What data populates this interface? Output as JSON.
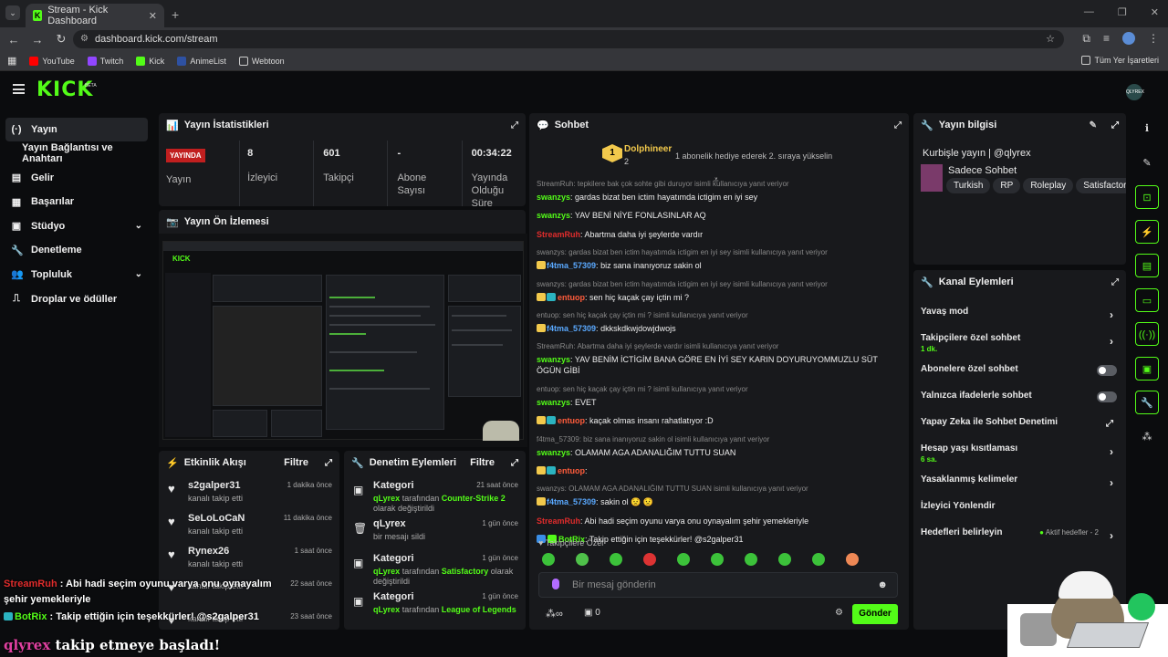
{
  "browser": {
    "tab_title": "Stream - Kick Dashboard",
    "url": "dashboard.kick.com/stream",
    "bookmarks": [
      {
        "label": "YouTube",
        "color": "#ff0000"
      },
      {
        "label": "Twitch",
        "color": "#9146ff"
      },
      {
        "label": "Kick",
        "color": "#53fc18"
      },
      {
        "label": "AnimeList",
        "color": "#2e51a2"
      },
      {
        "label": "Webtoon",
        "color": "#00dc64"
      }
    ],
    "bookmarks_right": "Tüm Yer İşaretleri"
  },
  "header": {
    "logo": "KICK",
    "beta": "BETA",
    "profile": "QLYREX"
  },
  "sidebar": {
    "items": [
      {
        "label": "Yayın",
        "icon": "(·)"
      },
      {
        "label": "Yayın Bağlantısı ve Anahtarı",
        "icon": ""
      },
      {
        "label": "Gelir",
        "icon": "▤"
      },
      {
        "label": "Başarılar",
        "icon": "▦"
      },
      {
        "label": "Stüdyo",
        "icon": "▣"
      },
      {
        "label": "Denetleme",
        "icon": "🔧"
      },
      {
        "label": "Topluluk",
        "icon": "👥"
      },
      {
        "label": "Droplar ve ödüller",
        "icon": "⎍"
      }
    ]
  },
  "stats": {
    "title": "Yayın İstatistikleri",
    "live": "YAYINDA",
    "items": [
      {
        "value": "",
        "label": "Yayın"
      },
      {
        "value": "8",
        "label": "İzleyici"
      },
      {
        "value": "601",
        "label": "Takipçi"
      },
      {
        "value": "-",
        "label": "Abone Sayısı"
      },
      {
        "value": "00:34:22",
        "label": "Yayında Olduğu Süre"
      }
    ]
  },
  "preview": {
    "title": "Yayın Ön İzlemesi",
    "overlay_user": "qlyrex",
    "overlay_text": "takip etmeye başladı!"
  },
  "activity": {
    "title": "Etkinlik Akışı",
    "filter": "Filtre",
    "rows": [
      {
        "name": "s2galper31",
        "desc": "kanalı takip etti",
        "time": "1 dakika önce"
      },
      {
        "name": "SeLoLoCaN",
        "desc": "kanalı takip etti",
        "time": "11 dakika önce"
      },
      {
        "name": "Rynex26",
        "desc": "kanalı takip etti",
        "time": "1 saat önce"
      },
      {
        "name": "",
        "desc": "kanalı takip etti",
        "time": "22 saat önce"
      },
      {
        "name": "",
        "desc": "kanalı takip etti",
        "time": "23 saat önce"
      }
    ]
  },
  "moderation": {
    "title": "Denetim Eylemleri",
    "filter": "Filtre",
    "rows": [
      {
        "title": "Kategori",
        "user": "qLyrex",
        "pre": "tarafından",
        "value": "Counter-Strike 2",
        "post": "olarak değiştirildi",
        "time": "21 saat önce"
      },
      {
        "title": "qLyrex",
        "user": "",
        "pre": "bir mesajı sildi",
        "value": "",
        "post": "",
        "time": "1 gün önce"
      },
      {
        "title": "Kategori",
        "user": "qLyrex",
        "pre": "tarafından",
        "value": "Satisfactory",
        "post": "olarak değiştirildi",
        "time": "1 gün önce"
      },
      {
        "title": "Kategori",
        "user": "qLyrex",
        "pre": "tarafından",
        "value": "League of Legends",
        "post": "",
        "time": "1 gün önce"
      }
    ]
  },
  "chat": {
    "title": "Sohbet",
    "pinned_user": "Dolphineer",
    "pinned_count": "2",
    "pinned_rank": "1",
    "pinned_text": "1 abonelik hediye ederek 2. sıraya yükselin",
    "messages": [
      {
        "reply": "StreamRuh: tepkilere bak çok sohte gibi duruyor isimli kullanıcıya yanıt veriyor",
        "user": "swanzys",
        "cls": "ug",
        "text": "gardas bizat ben ictim hayatımda ictigim en iyi sey",
        "badges": 0
      },
      {
        "reply": "",
        "user": "swanzys",
        "cls": "ug",
        "text": "YAV BENİ NİYE FONLASINLAR AQ",
        "badges": 0
      },
      {
        "reply": "",
        "user": "StreamRuh",
        "cls": "ur",
        "text": "Abartma daha iyi şeylerde vardır",
        "badges": 0
      },
      {
        "reply": "swanzys: gardas bizat ben ictim hayatımda ictigim en iyi sey isimli kullanıcıya yanıt veriyor",
        "user": "f4tma_57309",
        "cls": "ub",
        "text": "biz sana inanıyoruz sakin ol",
        "badges": 1
      },
      {
        "reply": "swanzys: gardas bizat ben ictim hayatımda ictigim en iyi sey isimli kullanıcıya yanıt veriyor",
        "user": "entuop",
        "cls": "uo",
        "text": "sen hiç kaçak çay içtin mi ?",
        "badges": 2
      },
      {
        "reply": "entuop: sen hiç kaçak çay içtin mi ? isimli kullanıcıya yanıt veriyor",
        "user": "f4tma_57309",
        "cls": "ub",
        "text": "dkkskdkwjdowjdwojs",
        "badges": 1
      },
      {
        "reply": "StreamRuh: Abartma daha iyi şeylerde vardır isimli kullanıcıya yanıt veriyor",
        "user": "swanzys",
        "cls": "ug",
        "text": "YAV BENİM İCTİGİM BANA GÖRE EN İYİ SEY KARIN DOYURUYOMMUZLU SÜT ÖGÜN GİBİ",
        "badges": 0
      },
      {
        "reply": "entuop: sen hiç kaçak çay içtin mi ? isimli kullanıcıya yanıt veriyor",
        "user": "swanzys",
        "cls": "ug",
        "text": "EVET",
        "badges": 0
      },
      {
        "reply": "",
        "user": "entuop",
        "cls": "uo",
        "text": "kaçak olmas insanı rahatlatıyor :D",
        "badges": 2
      },
      {
        "reply": "f4tma_57309: biz sana inanıyoruz sakin ol isimli kullanıcıya yanıt veriyor",
        "user": "swanzys",
        "cls": "ug",
        "text": "OLAMAM AGA ADANALIĞIM TUTTU SUAN",
        "badges": 0
      },
      {
        "reply": "",
        "user": "entuop",
        "cls": "uo",
        "text": "",
        "badges": 2
      },
      {
        "reply": "swanzys: OLAMAM AGA ADANALIĞIM TUTTU SUAN isimli kullanıcıya yanıt veriyor",
        "user": "f4tma_57309",
        "cls": "ub",
        "text": "sakin ol 😟 😟",
        "badges": 1
      },
      {
        "reply": "",
        "user": "StreamRuh",
        "cls": "ur",
        "text": "Abi hadi seçim oyunu varya onu oynayalım şehir yemekleriyle",
        "badges": 0
      },
      {
        "reply": "",
        "user": "BotRix",
        "cls": "ug",
        "text": "Takip ettiğin için teşekkürler! @s2galper31",
        "badges": 3
      }
    ],
    "followers_label": "Takipçilere Özel",
    "placeholder": "Bir mesaj gönderin",
    "count": "0",
    "send": "Gönder"
  },
  "info": {
    "title": "Yayın bilgisi",
    "stream_title": "Kurbişle yayın | @qlyrex",
    "chat_mode": "Sadece Sohbet",
    "tags": [
      "Turkish",
      "RP",
      "Roleplay",
      "Satisfactory"
    ]
  },
  "channel": {
    "title": "Kanal Eylemleri",
    "rows": [
      {
        "label": "Yavaş mod",
        "sub": "",
        "ctrl": "arrow"
      },
      {
        "label": "Takipçilere özel sohbet",
        "sub": "1 dk.",
        "ctrl": "arrow"
      },
      {
        "label": "Abonelere özel sohbet",
        "sub": "",
        "ctrl": "toggle"
      },
      {
        "label": "Yalnızca ifadelerle sohbet",
        "sub": "",
        "ctrl": "toggle"
      },
      {
        "label": "Yapay Zeka ile Sohbet Denetimi",
        "sub": "",
        "ctrl": "ext"
      },
      {
        "label": "Hesap yaşı kısıtlaması",
        "sub": "6 sa.",
        "ctrl": "arrow"
      },
      {
        "label": "Yasaklanmış kelimeler",
        "sub": "",
        "ctrl": "arrow"
      },
      {
        "label": "İzleyici Yönlendir",
        "sub": "",
        "ctrl": ""
      },
      {
        "label": "Hedefleri belirleyin",
        "sub": "",
        "ctrl": "arrow",
        "right": "Aktif hedefler - 2"
      }
    ]
  },
  "overlay": {
    "line1_user": "StreamRuh",
    "line1_text": " : Abi hadi seçim oyunu varya onu oynayalım",
    "line1b": "şehir yemekleriyle",
    "line2_user": "BotRix",
    "line2_text": " : Takip ettiğin için teşekkürler! @s2galper31",
    "line3_user": "qlyrex",
    "line3_text": "takip etmeye başladı!"
  },
  "colors": {
    "accent": "#53fc18",
    "panel": "#18191c",
    "bg": "#0b0c0e"
  }
}
